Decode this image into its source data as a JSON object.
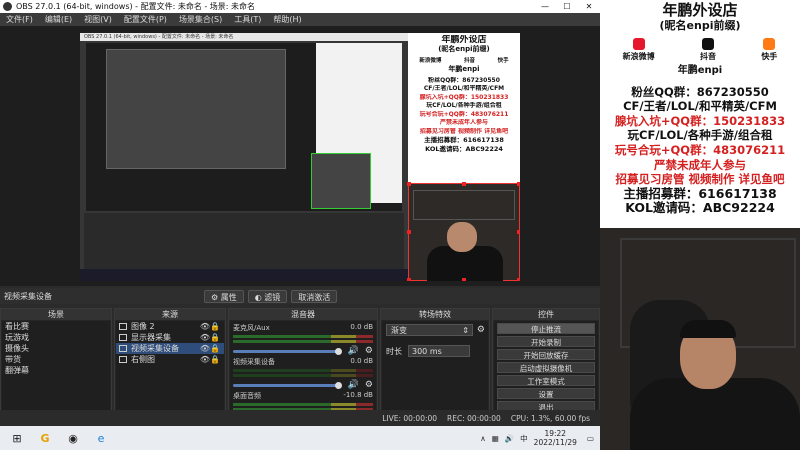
{
  "window": {
    "title": "OBS 27.0.1 (64-bit, windows) - 配置文件: 未命名 - 场景: 未命名",
    "controls": [
      "—",
      "☐",
      "✕"
    ]
  },
  "menu": [
    "文件(F)",
    "编辑(E)",
    "视图(V)",
    "配置文件(P)",
    "场景集合(S)",
    "工具(T)",
    "帮助(H)"
  ],
  "source_toolbar": {
    "current_source": "视频采集设备",
    "properties": "属性",
    "filters": "滤镜",
    "deactivate": "取消激活"
  },
  "scenes": {
    "title": "场景",
    "items": [
      "看比赛",
      "玩游戏",
      "摄像头",
      "带货",
      "翻弹幕"
    ]
  },
  "sources": {
    "title": "来源",
    "items": [
      {
        "name": "图像 2",
        "selected": false
      },
      {
        "name": "显示器采集",
        "selected": false
      },
      {
        "name": "视频采集设备",
        "selected": true
      },
      {
        "name": "右侧图",
        "selected": false
      }
    ]
  },
  "mixer": {
    "title": "混音器",
    "channels": [
      {
        "name": "麦克风/Aux",
        "db": "0.0 dB",
        "level": 0.7
      },
      {
        "name": "视频采集设备",
        "db": "0.0 dB",
        "level": 0.0
      },
      {
        "name": "桌面音频",
        "db": "-10.8 dB",
        "level": 0.55
      }
    ]
  },
  "transitions": {
    "title": "转场特效",
    "selected": "渐变",
    "duration_label": "时长",
    "duration": "300 ms"
  },
  "controls": {
    "title": "控件",
    "buttons": [
      "停止推流",
      "开始录制",
      "开始回放缓存",
      "启动虚拟摄像机",
      "工作室模式",
      "设置",
      "退出"
    ]
  },
  "status": {
    "live": "LIVE: 00:00:00",
    "rec": "REC: 00:00:00",
    "cpu": "CPU: 1.3%, 60.00 fps"
  },
  "poster": {
    "title": "年鹏外设店",
    "subtitle": "(昵名enpi前缀)",
    "socials": [
      {
        "name": "新浪微博",
        "color": "#e6162d"
      },
      {
        "name": "抖音",
        "color": "#111111"
      },
      {
        "name": "快手",
        "color": "#ff7a12"
      }
    ],
    "brand": "年鹏enpi",
    "lines": [
      {
        "text": "粉丝QQ群：867230550",
        "red": false
      },
      {
        "text": "CF/王者/LOL/和平精英/CFM",
        "red": false
      },
      {
        "text": "腺坑入坑+QQ群：150231833",
        "red": true
      },
      {
        "text": "玩CF/LOL/各种手游/组合租",
        "red": false
      },
      {
        "text": "玩号合玩+QQ群：483076211",
        "red": true
      },
      {
        "text": "严禁未成年人参与",
        "red": true
      },
      {
        "text": "招募见习房管 视频制作 详见鱼吧",
        "red": true
      },
      {
        "text": "主播招募群：616617138",
        "red": false
      },
      {
        "text": "KOL邀请码：ABC92224",
        "red": false
      }
    ]
  },
  "taskbar": {
    "time": "19:22",
    "date": "2022/11/29",
    "lang": "中",
    "icons": [
      "windows-icon",
      "chrome-icon",
      "obs-icon",
      "edge-icon"
    ]
  }
}
